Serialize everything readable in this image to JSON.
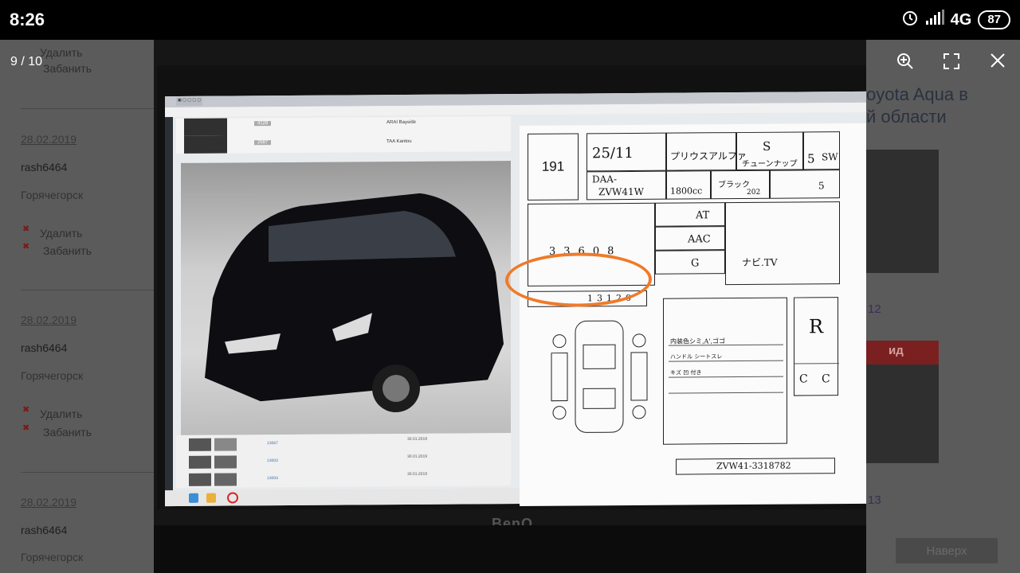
{
  "status_bar": {
    "time": "8:26",
    "network": "4G",
    "battery": "87"
  },
  "viewer": {
    "counter": "9 / 10",
    "zoom_icon": "zoom-in-icon",
    "fullscreen_icon": "fullscreen-icon",
    "close_icon": "close-icon"
  },
  "background_page": {
    "top_actions": {
      "delete": "Удалить",
      "ban": "Забанить"
    },
    "comments": [
      {
        "date": "28.02.2019",
        "user": "rash6464",
        "city": "Горячегорск",
        "delete": "Удалить",
        "ban": "Забанить"
      },
      {
        "date": "28.02.2019",
        "user": "rash6464",
        "city": "Горячегорск",
        "delete": "Удалить",
        "ban": "Забанить"
      },
      {
        "date": "28.02.2019",
        "user": "rash6464",
        "city": "Горячегорск"
      }
    ],
    "right_title_line1": "oyota Aqua в",
    "right_title_line2": "й области",
    "right_num_1": "12",
    "right_num_2": "13",
    "right_badge": "ид",
    "up_button": "Наверх"
  },
  "photo": {
    "monitor_brand": "BenQ",
    "auction_sheet": {
      "lot_number": "191",
      "year": "25/11",
      "model_name": "プリウスアルファ",
      "grade": "S",
      "grade_sub": "チューンナップ",
      "doors": "5",
      "body": "SW",
      "model_code": "DAA-",
      "chassis": "ZVW41W",
      "displacement": "1800cc",
      "color": "ブラック",
      "color_code": "202",
      "capacity": "5",
      "shift": "AT",
      "ac": "AAC",
      "fuel": "G",
      "mileage": "33608",
      "options": "ナビ.TV",
      "recycle": "13120",
      "report_line1": "内装色シミ,A',ゴゴ",
      "report_line2": "ハンドル シートスレ",
      "report_line3": "キズ 凹 付き",
      "score_interior": "R",
      "score_c1": "C",
      "score_c2": "C",
      "frame_number": "ZVW41-3318782"
    },
    "list_rows": [
      {
        "id": "4128",
        "info": "ARAI Bayside"
      },
      {
        "id": "2687",
        "info": "TAA Kantou"
      }
    ],
    "thumb_rows": [
      {
        "id": "13067",
        "date": "30.01.2019"
      },
      {
        "id": "13003",
        "date": "30.01.2019"
      },
      {
        "id": "13004",
        "date": "30.01.2019"
      }
    ]
  }
}
